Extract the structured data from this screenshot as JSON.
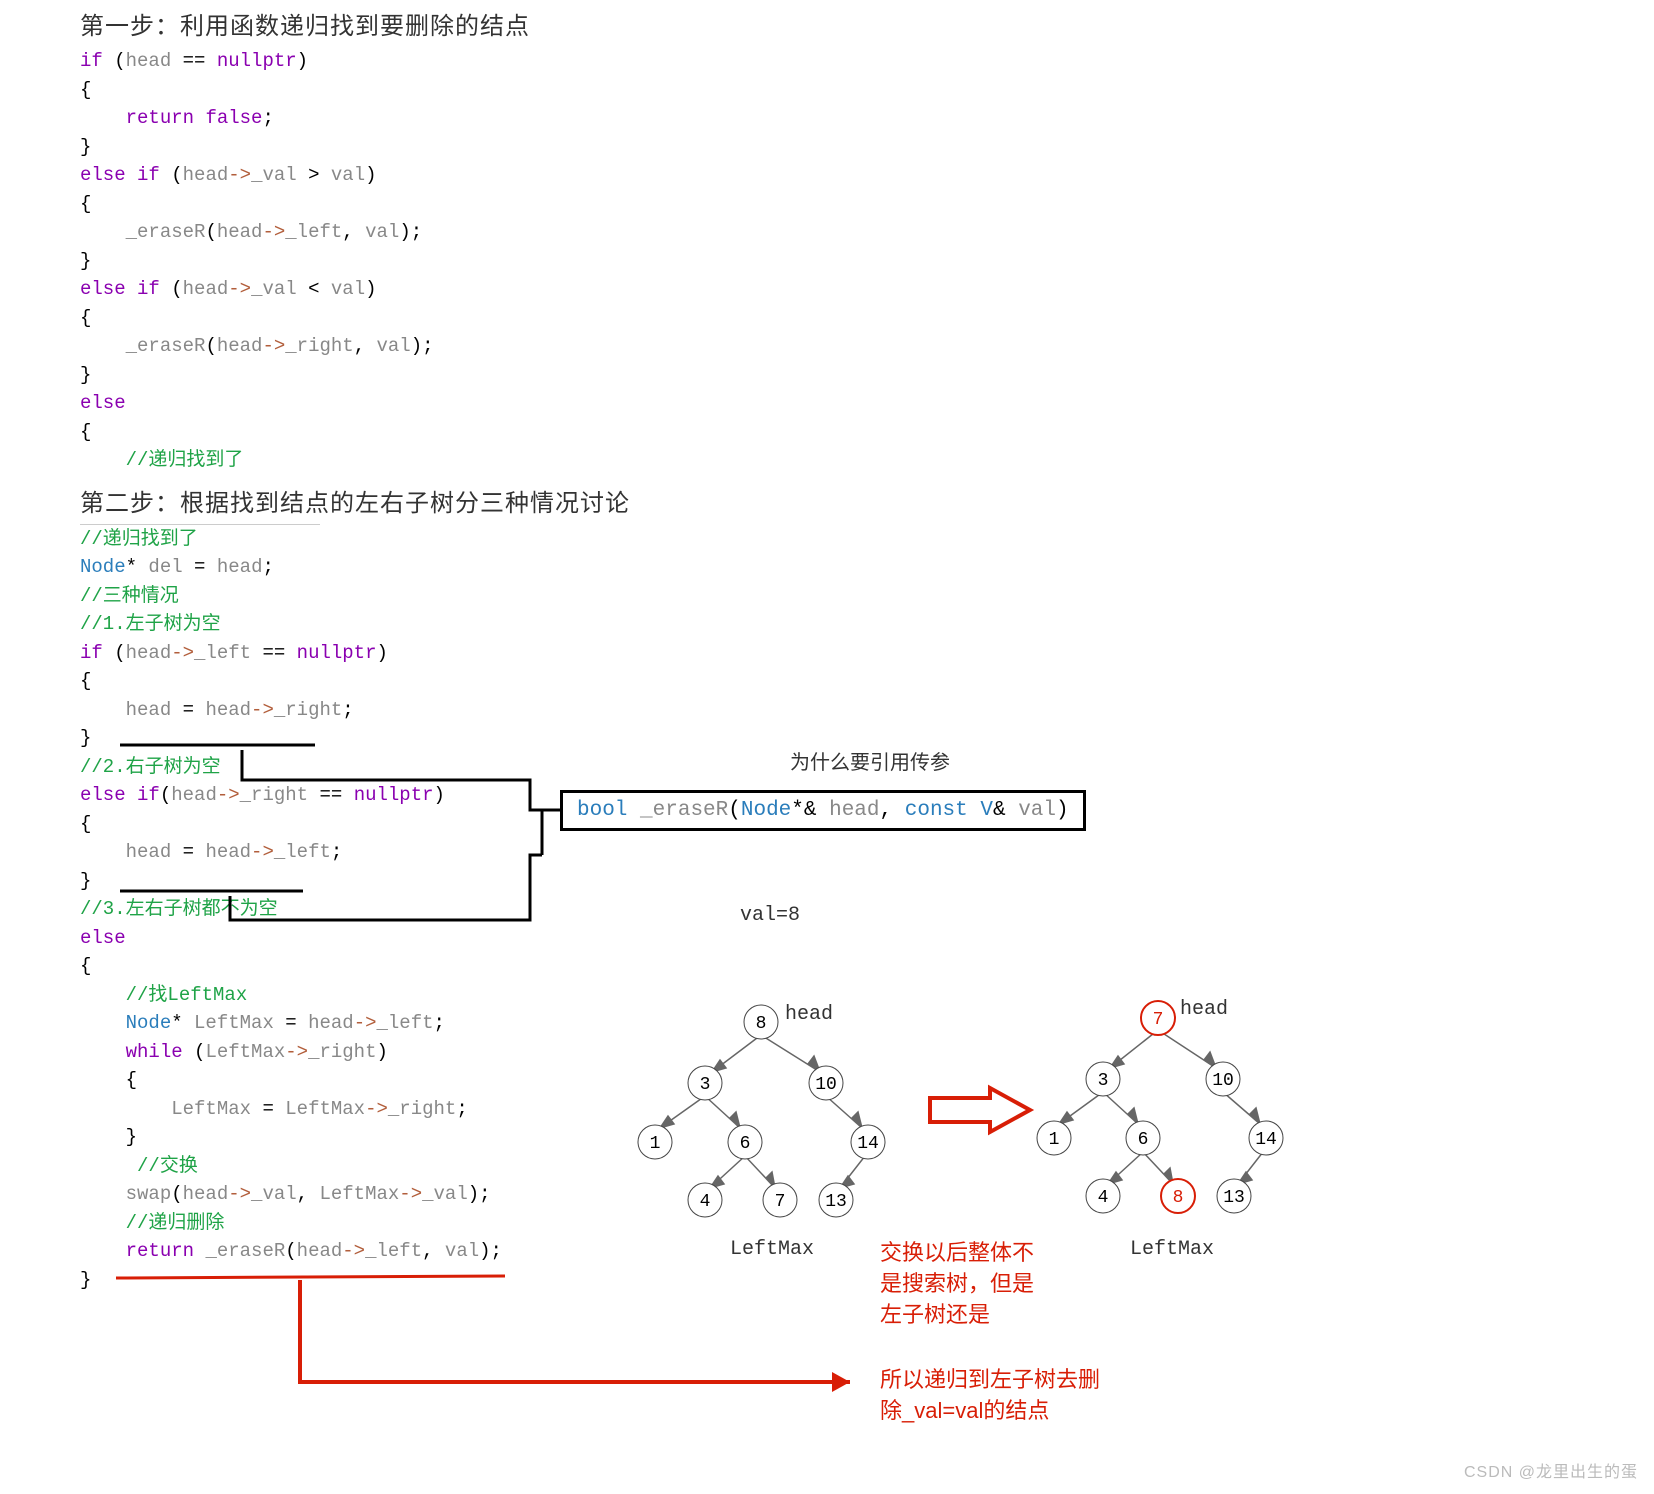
{
  "heading1": "第一步：利用函数递归找到要删除的结点",
  "heading2": "第二步：根据找到结点的左右子树分三种情况讨论",
  "code1": {
    "l1a": "if",
    "l1b": " (",
    "l1c": "head",
    "l1d": " == ",
    "l1e": "nullptr",
    "l1f": ")",
    "l2": "{",
    "l3a": "    ",
    "l3b": "return",
    "l3c": " ",
    "l3d": "false",
    "l3e": ";",
    "l4": "}",
    "l5a": "else",
    "l5b": " ",
    "l5c": "if",
    "l5d": " (",
    "l5e": "head",
    "l5f": "->",
    "l5g": "_val",
    "l5h": " > ",
    "l5i": "val",
    "l5j": ")",
    "l6": "{",
    "l7a": "    ",
    "l7b": "_eraseR",
    "l7c": "(",
    "l7d": "head",
    "l7e": "->",
    "l7f": "_left",
    "l7g": ", ",
    "l7h": "val",
    "l7i": ");",
    "l8": "}",
    "l9a": "else",
    "l9b": " ",
    "l9c": "if",
    "l9d": " (",
    "l9e": "head",
    "l9f": "->",
    "l9g": "_val",
    "l9h": " < ",
    "l9i": "val",
    "l9j": ")",
    "l10": "{",
    "l11a": "    ",
    "l11b": "_eraseR",
    "l11c": "(",
    "l11d": "head",
    "l11e": "->",
    "l11f": "_right",
    "l11g": ", ",
    "l11h": "val",
    "l11i": ");",
    "l12": "}",
    "l13": "else",
    "l14": "{",
    "l15a": "    ",
    "l15b": "//递归找到了"
  },
  "code2": {
    "c1": "//递归找到了",
    "c2a": "Node",
    "c2b": "* ",
    "c2c": "del",
    "c2d": " = ",
    "c2e": "head",
    "c2f": ";",
    "c3": "//三种情况",
    "c4": "//1.左子树为空",
    "c5a": "if",
    "c5b": " (",
    "c5c": "head",
    "c5d": "->",
    "c5e": "_left",
    "c5f": " == ",
    "c5g": "nullptr",
    "c5h": ")",
    "c6": "{",
    "c7a": "    ",
    "c7b": "head",
    "c7c": " = ",
    "c7d": "head",
    "c7e": "->",
    "c7f": "_right",
    "c7g": ";",
    "c8": "}",
    "c9": "//2.右子树为空",
    "c10a": "else",
    "c10b": " ",
    "c10c": "if",
    "c10d": "(",
    "c10e": "head",
    "c10f": "->",
    "c10g": "_right",
    "c10h": " == ",
    "c10i": "nullptr",
    "c10j": ")",
    "c11": "{",
    "c12a": "    ",
    "c12b": "head",
    "c12c": " = ",
    "c12d": "head",
    "c12e": "->",
    "c12f": "_left",
    "c12g": ";",
    "c13": "}",
    "c14": "//3.左右子树都不为空",
    "c15": "else",
    "c16": "{",
    "c17a": "    ",
    "c17b": "//找LeftMax",
    "c18a": "    ",
    "c18b": "Node",
    "c18c": "* ",
    "c18d": "LeftMax",
    "c18e": " = ",
    "c18f": "head",
    "c18g": "->",
    "c18h": "_left",
    "c18i": ";",
    "c19a": "    ",
    "c19b": "while",
    "c19c": " (",
    "c19d": "LeftMax",
    "c19e": "->",
    "c19f": "_right",
    "c19g": ")",
    "c20a": "    {",
    "c21a": "        ",
    "c21b": "LeftMax",
    "c21c": " = ",
    "c21d": "LeftMax",
    "c21e": "->",
    "c21f": "_right",
    "c21g": ";",
    "c22a": "    }",
    "c23a": "     ",
    "c23b": "//交换",
    "c24a": "    ",
    "c24b": "swap",
    "c24c": "(",
    "c24d": "head",
    "c24e": "->",
    "c24f": "_val",
    "c24g": ", ",
    "c24h": "LeftMax",
    "c24i": "->",
    "c24j": "_val",
    "c24k": ");",
    "c25a": "    ",
    "c25b": "//递归删除",
    "c26a": "    ",
    "c26b": "return",
    "c26c": " ",
    "c26d": "_eraseR",
    "c26e": "(",
    "c26f": "head",
    "c26g": "->",
    "c26h": "_left",
    "c26i": ", ",
    "c26j": "val",
    "c26k": ");",
    "c27": "}"
  },
  "annotations": {
    "why_ref": "为什么要引用传参",
    "val8": "val=8",
    "head": "head",
    "leftmax": "LeftMax",
    "swap_note": "交换以后整体不\n是搜索树，但是\n左子树还是",
    "recurse_note": "所以递归到左子树去删\n除_val=val的结点"
  },
  "signature": {
    "s1": "bool",
    "s2": " ",
    "s3": "_eraseR",
    "s4": "(",
    "s5": "Node",
    "s6": "*& ",
    "s7": "head",
    "s8": ", ",
    "s9": "const",
    "s10": " ",
    "s11": "V",
    "s12": "& ",
    "s13": "val",
    "s14": ")"
  },
  "tree1": {
    "n1": "8",
    "n2": "3",
    "n3": "10",
    "n4": "1",
    "n5": "6",
    "n6": "14",
    "n7": "4",
    "n8": "7",
    "n9": "13"
  },
  "tree2": {
    "n1": "7",
    "n2": "3",
    "n3": "10",
    "n4": "1",
    "n5": "6",
    "n6": "14",
    "n7": "4",
    "n8": "8",
    "n9": "13"
  },
  "watermark": "CSDN @龙里出生的蛋"
}
